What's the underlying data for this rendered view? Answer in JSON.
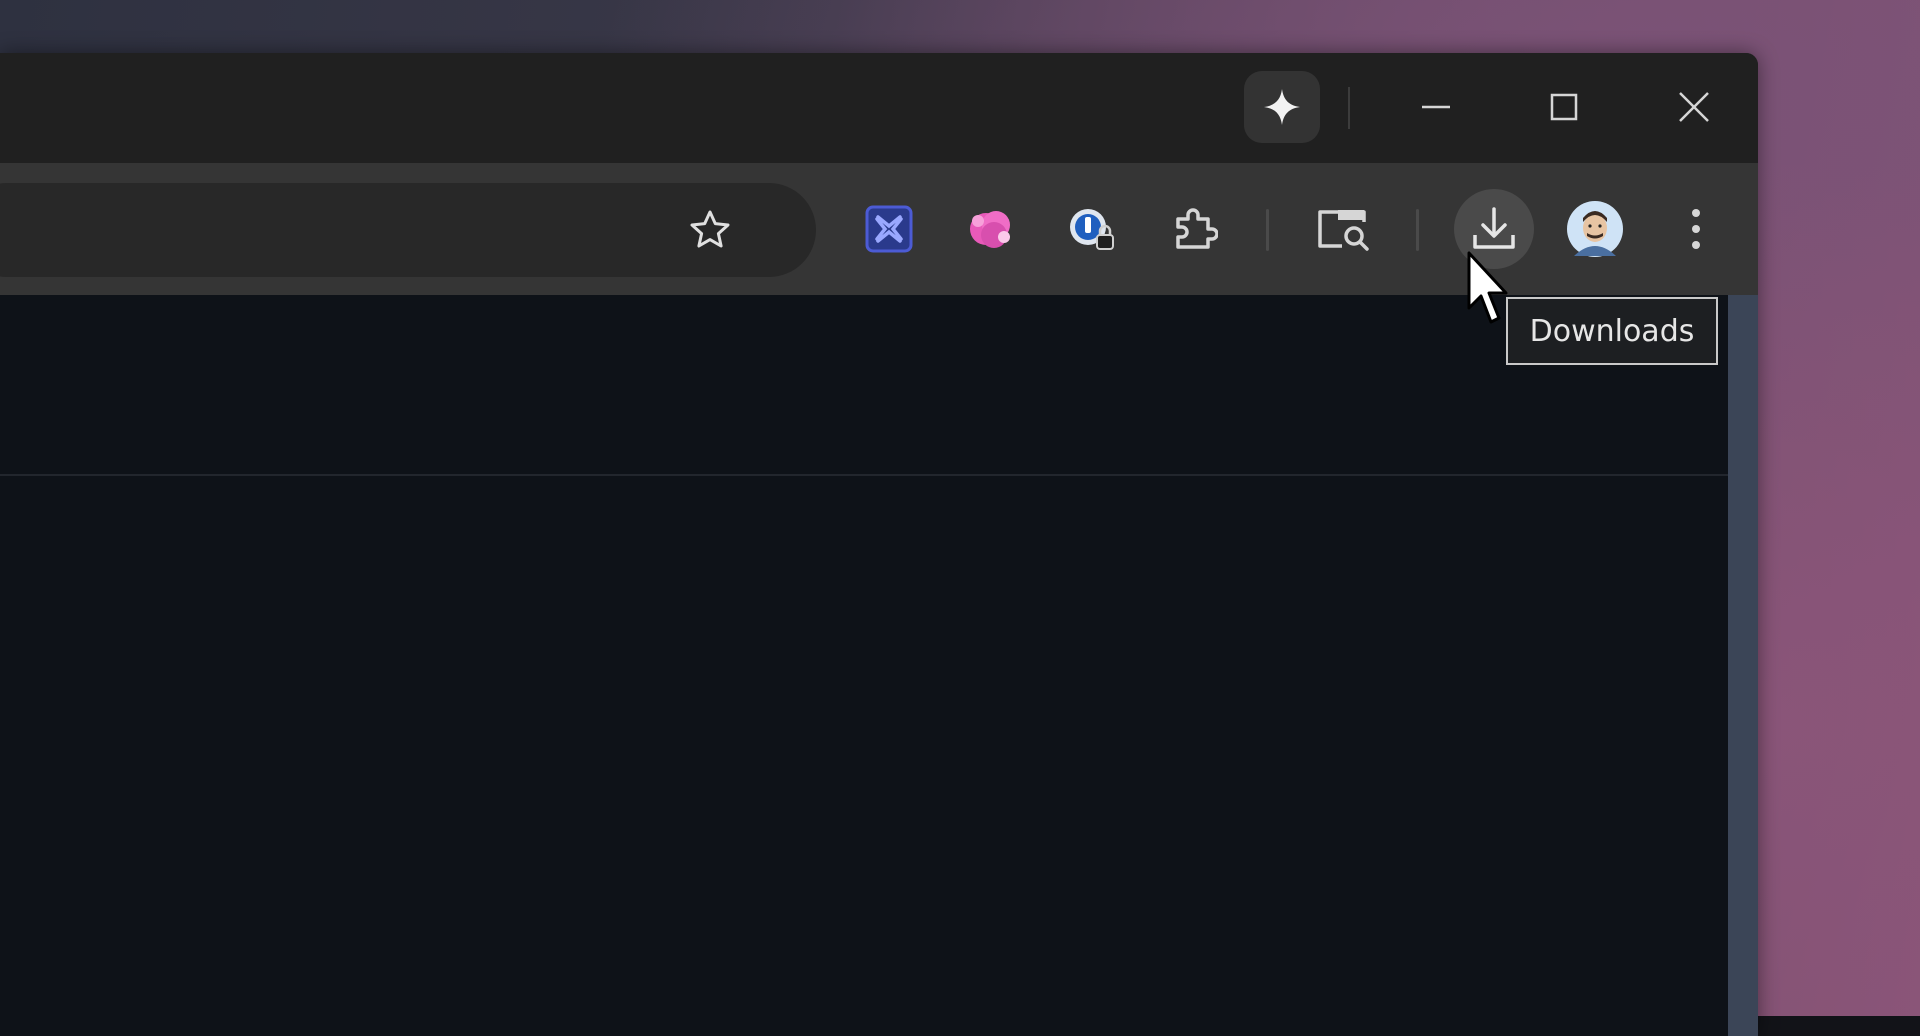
{
  "window": {
    "controls": {
      "gemini_icon": "sparkle-icon",
      "minimize_icon": "minimize-icon",
      "maximize_icon": "maximize-icon",
      "close_icon": "close-icon"
    }
  },
  "toolbar": {
    "bookmark_icon": "star-icon",
    "extensions": [
      {
        "name": "blue-x-extension-icon"
      },
      {
        "name": "pink-blob-extension-icon"
      },
      {
        "name": "password-manager-extension-icon"
      },
      {
        "name": "puzzle-extensions-icon"
      }
    ],
    "tab_search_icon": "tab-search-icon",
    "downloads_icon": "download-icon",
    "profile_icon": "avatar",
    "menu_icon": "kebab-menu-icon"
  },
  "tooltip": {
    "text": "Downloads"
  },
  "colors": {
    "titlebar": "#202020",
    "toolbar": "#353535",
    "omnibox": "#282828",
    "content": "#0e1218",
    "scrollbar": "#3b4557",
    "accent_blue": "#4c5bd4",
    "accent_pink": "#e85ab9"
  }
}
